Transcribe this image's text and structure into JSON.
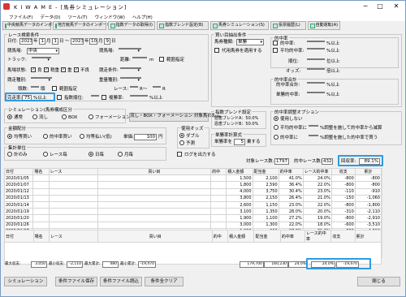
{
  "window": {
    "title": "K I W A M E - [馬券シミュレーション]",
    "min": "─",
    "max": "□",
    "close": "✕"
  },
  "menu": [
    "ファイル(F)",
    "データ(D)",
    "ツール(T)",
    "ウィンドウ(W)",
    "ヘルプ(H)"
  ],
  "toolbar": [
    "中央競馬データのインポート(J)",
    "地方競馬データのインポート(N)",
    "指数データの取得(I)",
    "指数ブレンド設定(B)",
    "馬券シミュレーション(S)",
    "投票履歴(L)",
    "自動運転(A)"
  ],
  "race_cond": {
    "legend": "レース検索条件",
    "date_label": "日付:",
    "date_from_y": "2023",
    "date_from_m": "1",
    "date_from_d": "1",
    "date_to_y": "2023",
    "date_to_m": "10",
    "date_to_d": "9",
    "nen": "年",
    "tsuki": "月",
    "nichi": "日",
    "tilde": "～",
    "track_label": "競馬場:",
    "track_val": "中央",
    "racetrack_label": "競馬場:",
    "track2_label": "トラック:",
    "distance_label": "距離:",
    "distance_unit": "m",
    "range1": "範囲指定",
    "going_label": "馬場状態:",
    "going": [
      "良",
      "稍重",
      "重",
      "不良"
    ],
    "racetype_label": "競走種別:",
    "class_label": "競走条件:",
    "weight_label": "重量種別:",
    "range2": "範囲指定",
    "headcount_label": "頭数:",
    "headcount_unit": "頭",
    "range3": "範囲指定",
    "race_label": "レース:",
    "race_r1": "R～",
    "race_r2": "R",
    "finish_label": "完走率:",
    "finish_val": "75",
    "finish_unit": "%以上",
    "pop_label": "指数順位:",
    "pop_unit": "位",
    "kind_label": "複勝率:",
    "kind_unit": "%以上"
  },
  "bet_cond": {
    "legend": "買い目抽出条件",
    "type_label": "馬券種類:",
    "type_val": "単勝",
    "jyuryo": "代用馬券を適用する",
    "odds_legend": "的中率",
    "hit_label": "的中率:",
    "hit_unit": "%以上",
    "avg_label": "平均的中率:",
    "avg_unit": "%以上",
    "rank_label": "順位:",
    "rank_unit": "位以上",
    "odds_label": "オッズ:",
    "odds_unit": "倍以上",
    "ev_legend": "的中率合計",
    "ev1": "的中率合計:",
    "ev1_unit": "%以上",
    "ev2": "単勝的中率:",
    "ev2_unit": "%以上"
  },
  "sim": {
    "legend": "シミュレーション(馬券構成区分",
    "opts": [
      "通常",
      "流し",
      "BOX",
      "フォーメーション"
    ],
    "flow_btn": "流し・BOX・フォーメーション 対象馬の設定"
  },
  "amount": {
    "legend": "金額配分",
    "opts": [
      "均等買い",
      "的中率買い",
      "均等払い(低)"
    ],
    "unit_label": "単価:",
    "unit_val": "100",
    "unit_yen": "円"
  },
  "total": {
    "legend": "集計単位",
    "opts": [
      "計のみ",
      "レース毎",
      "日毎",
      "月毎"
    ]
  },
  "odds_use": {
    "legend": "使用オッズ",
    "opts": [
      "ダブル",
      "予測"
    ],
    "log": "ログを出力する"
  },
  "blend": {
    "legend": "指数ブレンド設定",
    "line1": "恩恵ブレンドA：50.0%",
    "line2": "恩恵ブレンドB：50.0%",
    "calc_legend": "単勝率計算式",
    "calc_label": "単勝率を",
    "calc_val": "5",
    "calc_unit": "乗する"
  },
  "option": {
    "legend": "的中率調整オプション",
    "use": "使用しない",
    "o1": "平均的中率に",
    "o1b": "%調整を施して的中率から減算",
    "o2": "的中率に",
    "o2b": "%調整を施した的中率で買う"
  },
  "stats": {
    "target_label": "対象レース数:",
    "target_val": "1797",
    "hit_label": "的中レース数:",
    "hit_val": "432",
    "rate_label": "回収率:",
    "rate_val": "89.1%"
  },
  "table": {
    "headers": [
      "日付",
      "場名",
      "レース",
      "買い目",
      "的中",
      "積入金額",
      "配当金",
      "的中率",
      "レース的中率",
      "収支",
      "累計"
    ],
    "rows": [
      [
        "2020/01/05",
        "",
        "",
        "",
        "",
        "1,500",
        "2,100",
        "41.0%",
        "24.0%",
        "-800",
        "-800"
      ],
      [
        "2020/01/07",
        "",
        "",
        "",
        "",
        "1,800",
        "2,590",
        "36.4%",
        "22.0%",
        "-800",
        "-800"
      ],
      [
        "2020/01/12",
        "",
        "",
        "",
        "",
        "4,000",
        "3,750",
        "30.4%",
        "23.0%",
        "-110",
        "-910"
      ],
      [
        "2020/01/13",
        "",
        "",
        "",
        "",
        "3,800",
        "2,150",
        "26.4%",
        "21.0%",
        "-150",
        "-1,060"
      ],
      [
        "2020/01/14",
        "",
        "",
        "",
        "",
        "2,600",
        "1,150",
        "23.0%",
        "22.0%",
        "-800",
        "-1,800"
      ],
      [
        "2020/01/19",
        "",
        "",
        "",
        "",
        "3,100",
        "1,350",
        "28.0%",
        "20.0%",
        "-310",
        "-2,110"
      ],
      [
        "2020/01/20",
        "",
        "",
        "",
        "",
        "1,900",
        "1,100",
        "27.2%",
        "19.0%",
        "-800",
        "-2,910"
      ],
      [
        "2020/01/26",
        "",
        "",
        "",
        "",
        "3,000",
        "1,300",
        "22.0%",
        "18.0%",
        "-600",
        "-3,510"
      ],
      [
        "2020/01/27",
        "",
        "",
        "",
        "",
        "1,000",
        "600",
        "27.0%",
        "21.0%",
        "-800",
        "-4,310"
      ]
    ]
  },
  "table2": {
    "headers": [
      "日付",
      "場名",
      "レース",
      "買い目",
      "的中",
      "積入金額",
      "配当金",
      "的中率",
      "レース的中率",
      "収支",
      "累計"
    ]
  },
  "summary": {
    "max_hit": "最大収支:",
    "max_hit_v": "3,050",
    "min_bal": "最小収支:",
    "min_bal_v": "-2,110",
    "max_acc": "最大累計:",
    "max_acc_v": "480",
    "min_acc": "最小累計:",
    "min_acc_v": "-19,470",
    "tot_bet": "179,700",
    "tot_pay": "160,230",
    "tot_rate": "24.0%",
    "tot_race": "24.0%",
    "tot_bal": "-19,470"
  },
  "bottom": {
    "sim": "シミュレーション",
    "save": "条件ファイル保存",
    "load": "条件ファイル読込",
    "clear": "条件全クリア",
    "close": "閉じる"
  }
}
